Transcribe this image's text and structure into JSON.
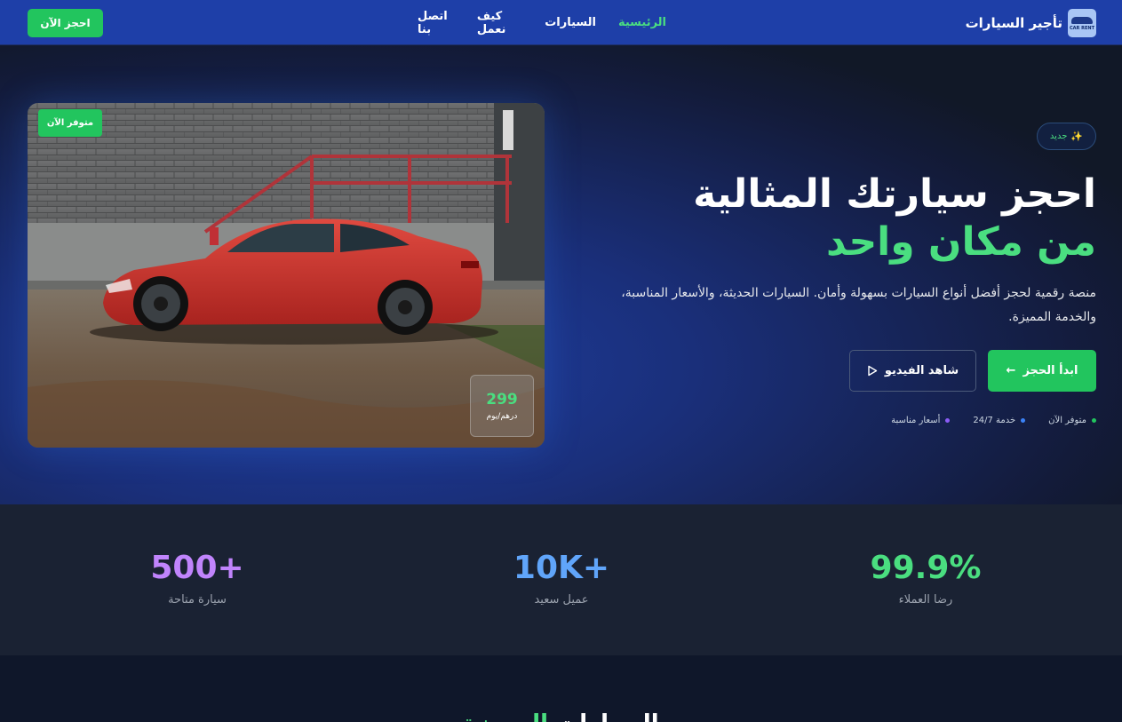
{
  "nav": {
    "brand_name": "تأجير السيارات",
    "logo_text": "CAR RENT",
    "links": [
      {
        "label": "الرئيسية",
        "active": true
      },
      {
        "label": "السيارات",
        "active": false
      },
      {
        "label": "كيف نعمل",
        "active": false
      },
      {
        "label": "اتصل بنا",
        "active": false
      }
    ],
    "book_button": "احجز الآن"
  },
  "hero": {
    "tag": "جديد",
    "tag_icon": "sparkles-icon",
    "title_line1": "احجز سيارتك المثالية",
    "title_line2": "من مكان واحد",
    "description": "منصة رقمية لحجز أفضل أنواع السيارات بسهولة وأمان. السيارات الحديثة، والأسعار المناسبة، والخدمة المميزة.",
    "start_button": "ابدأ الحجز",
    "start_icon": "arrow-left-icon",
    "video_button": "شاهد الفيديو",
    "video_icon": "play-icon",
    "features": [
      {
        "label": "متوفر الآن",
        "color": "#22c55e"
      },
      {
        "label": "خدمة 24/7",
        "color": "#3b82f6"
      },
      {
        "label": "أسعار مناسبة",
        "color": "#8b5cf6"
      }
    ],
    "car_card": {
      "availability_badge": "متوفر الآن",
      "price": "299",
      "price_unit": "درهم/يوم"
    }
  },
  "stats": [
    {
      "value": "99.9%",
      "label": "رضا العملاء",
      "color": "#4ade80"
    },
    {
      "value": "10K+",
      "label": "عميل سعيد",
      "color": "#60a5fa"
    },
    {
      "value": "500+",
      "label": "سيارة متاحة",
      "color": "#c084fc"
    }
  ],
  "next_section": {
    "heading_white": "السيارات",
    "heading_green": "المميزة"
  },
  "colors": {
    "accent": "#22c55e",
    "nav_bg": "#1e3fa8",
    "stats_bg": "#1a2233"
  }
}
